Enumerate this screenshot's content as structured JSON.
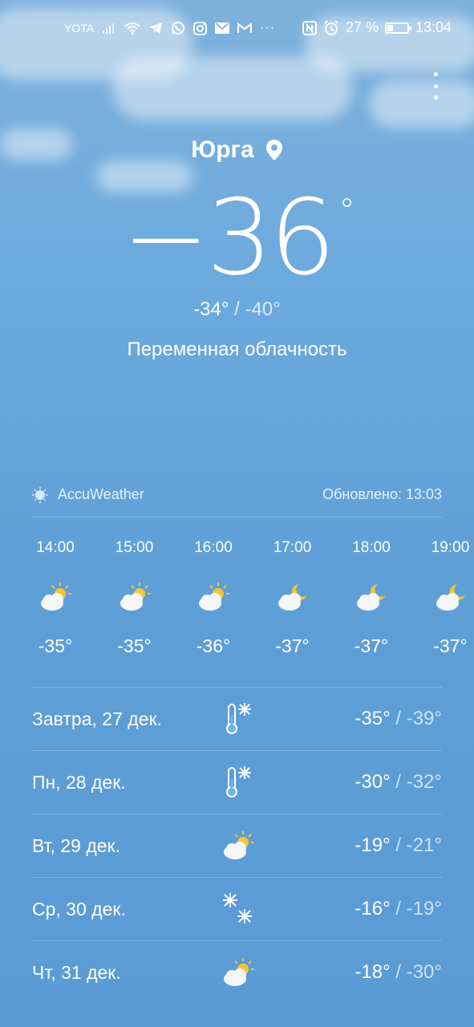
{
  "status_bar": {
    "carrier": "YOTA",
    "battery_percent": "27 %",
    "battery_level": 0.27,
    "time": "13:04",
    "icons": [
      "signal-icon",
      "wifi-icon",
      "telegram-icon",
      "whatsapp-icon",
      "instagram-icon",
      "mail-icon",
      "gmail-icon",
      "more-icon",
      "nfc-icon",
      "alarm-icon"
    ]
  },
  "location": {
    "city": "Юрга"
  },
  "current": {
    "temp": "−36",
    "degree": "°",
    "high": "-34°",
    "separator": "/",
    "low": "-40°",
    "condition": "Переменная облачность"
  },
  "source": {
    "provider": "AccuWeather",
    "updated": "Обновлено: 13:03"
  },
  "hourly": [
    {
      "time": "14:00",
      "icon": "partly-sunny-icon",
      "temp": "-35°"
    },
    {
      "time": "15:00",
      "icon": "partly-sunny-icon",
      "temp": "-35°"
    },
    {
      "time": "16:00",
      "icon": "partly-sunny-icon",
      "temp": "-36°"
    },
    {
      "time": "17:00",
      "icon": "night-cloudy-icon",
      "temp": "-37°"
    },
    {
      "time": "18:00",
      "icon": "night-cloudy-icon",
      "temp": "-37°"
    },
    {
      "time": "19:00",
      "icon": "night-cloudy-icon",
      "temp": "-37°"
    }
  ],
  "daily": [
    {
      "label": "Завтра, 27 дек.",
      "icon": "frost-icon",
      "high": "-35°",
      "separator": " / ",
      "low": "-39°"
    },
    {
      "label": "Пн, 28 дек.",
      "icon": "frost-icon",
      "high": "-30°",
      "separator": " / ",
      "low": "-32°"
    },
    {
      "label": "Вт, 29 дек.",
      "icon": "partly-sunny-icon",
      "high": "-19°",
      "separator": " / ",
      "low": "-21°"
    },
    {
      "label": "Ср, 30 дек.",
      "icon": "snow-icon",
      "high": "-16°",
      "separator": " / ",
      "low": "-19°"
    },
    {
      "label": "Чт, 31 дек.",
      "icon": "partly-sunny-icon",
      "high": "-18°",
      "separator": " / ",
      "low": "-30°"
    }
  ],
  "colors": {
    "sun": "#f7c531",
    "cloud": "#f4f6f8",
    "moon": "#f7c531",
    "thermometer": "#6ab7e8"
  }
}
